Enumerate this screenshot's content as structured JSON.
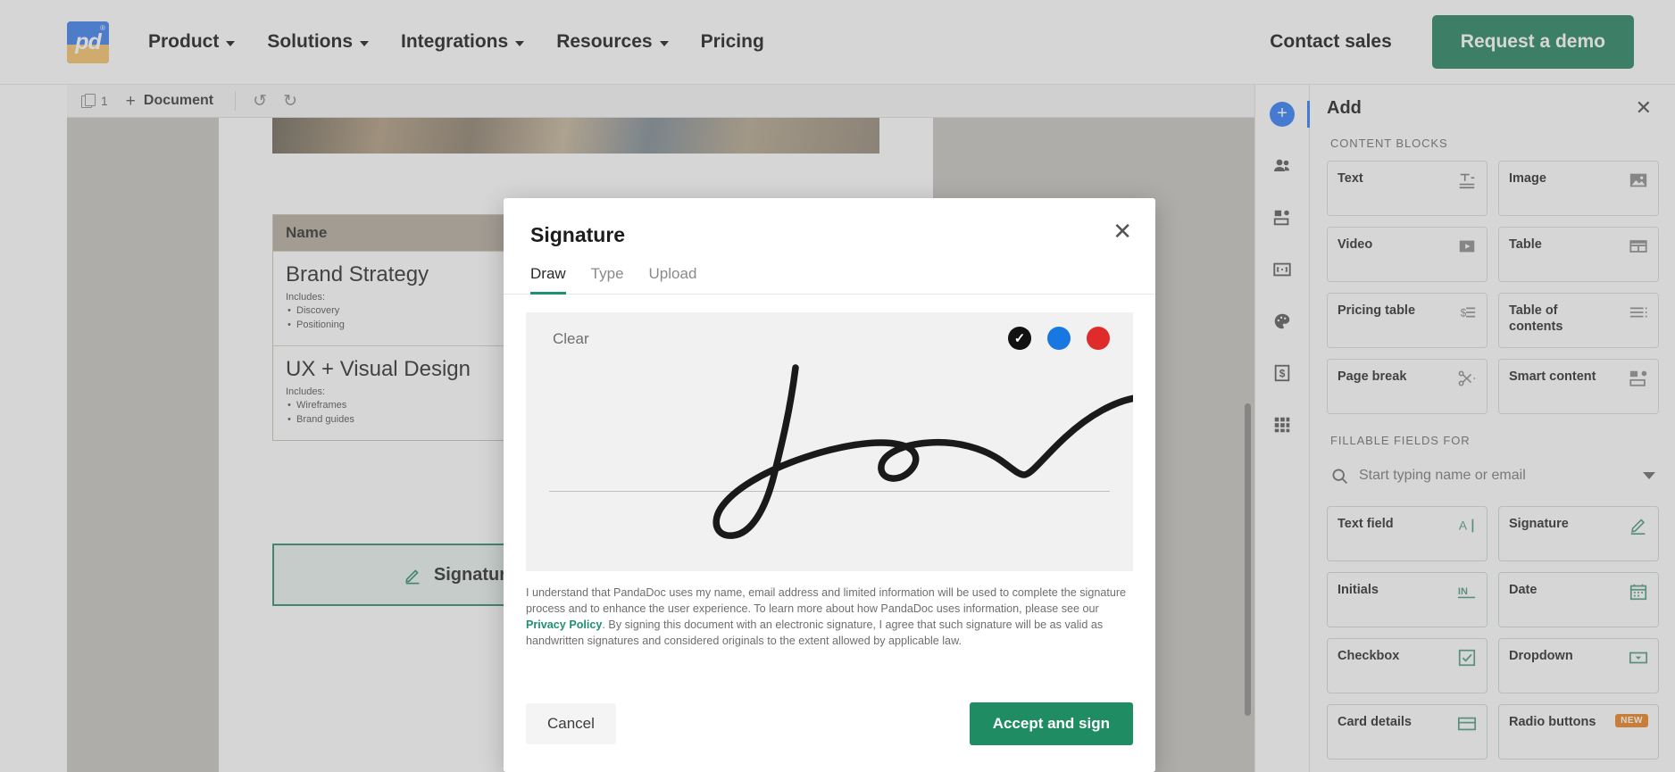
{
  "site_header": {
    "logo_text": "pd",
    "logo_tm": "®",
    "nav": [
      {
        "label": "Product",
        "has_caret": true
      },
      {
        "label": "Solutions",
        "has_caret": true
      },
      {
        "label": "Integrations",
        "has_caret": true
      },
      {
        "label": "Resources",
        "has_caret": true
      },
      {
        "label": "Pricing",
        "has_caret": false
      }
    ],
    "contact_sales": "Contact sales",
    "demo_button": "Request a demo",
    "accent_green": "#23815f",
    "logo_blue": "#3b7ff0",
    "logo_yellow": "#f5c26b"
  },
  "editor_toolbar": {
    "page_count": "1",
    "document_label": "Document",
    "plus_glyph": "+",
    "undo_glyph": "↺",
    "redo_glyph": "↻"
  },
  "document": {
    "table_header": "Name",
    "rows": [
      {
        "title": "Brand Strategy",
        "includes_label": "Includes:",
        "items": [
          "Discovery",
          "Positioning"
        ]
      },
      {
        "title": "UX + Visual Design",
        "includes_label": "Includes:",
        "items": [
          "Wireframes",
          "Brand guides"
        ]
      }
    ],
    "signature_field_label": "Signature",
    "signature_field_border": "#2e8b6a"
  },
  "icon_rail": [
    {
      "name": "add-plus-icon",
      "active": true
    },
    {
      "name": "recipients-icon",
      "active": false
    },
    {
      "name": "content-library-icon",
      "active": false
    },
    {
      "name": "variables-icon",
      "active": false
    },
    {
      "name": "theme-palette-icon",
      "active": false
    },
    {
      "name": "pricing-dollar-icon",
      "active": false
    },
    {
      "name": "apps-grid-icon",
      "active": false
    }
  ],
  "add_panel": {
    "title": "Add",
    "close_glyph": "✕",
    "content_blocks_label": "Content blocks",
    "content_blocks": [
      {
        "label": "Text",
        "icon": "text-block-icon"
      },
      {
        "label": "Image",
        "icon": "image-block-icon"
      },
      {
        "label": "Video",
        "icon": "video-block-icon"
      },
      {
        "label": "Table",
        "icon": "table-block-icon"
      },
      {
        "label": "Pricing table",
        "icon": "pricing-table-icon"
      },
      {
        "label": "Table of contents",
        "icon": "table-of-contents-icon"
      },
      {
        "label": "Page break",
        "icon": "page-break-scissors-icon"
      },
      {
        "label": "Smart content",
        "icon": "smart-content-icon"
      }
    ],
    "fillable_fields_label": "Fillable fields for",
    "search_placeholder": "Start typing name or email",
    "fillable_fields": [
      {
        "label": "Text field",
        "icon": "text-field-icon",
        "badge": ""
      },
      {
        "label": "Signature",
        "icon": "signature-pen-icon",
        "badge": ""
      },
      {
        "label": "Initials",
        "icon": "initials-icon",
        "badge": ""
      },
      {
        "label": "Date",
        "icon": "calendar-icon",
        "badge": ""
      },
      {
        "label": "Checkbox",
        "icon": "checkbox-icon",
        "badge": ""
      },
      {
        "label": "Dropdown",
        "icon": "dropdown-icon",
        "badge": ""
      },
      {
        "label": "Card details",
        "icon": "credit-card-icon",
        "badge": ""
      },
      {
        "label": "Radio buttons",
        "icon": "radio-buttons-icon",
        "badge": "NEW"
      }
    ],
    "badge_color": "#e8821e",
    "field_accent": "#4f9b80"
  },
  "signature_modal": {
    "title": "Signature",
    "close_glyph": "✕",
    "tabs": [
      {
        "label": "Draw",
        "active": true
      },
      {
        "label": "Type",
        "active": false
      },
      {
        "label": "Upload",
        "active": false
      }
    ],
    "active_tab_color": "#1f9171",
    "clear_label": "Clear",
    "colors": [
      {
        "name": "black",
        "hex": "#111111",
        "selected": true
      },
      {
        "name": "blue",
        "hex": "#1877e0",
        "selected": false
      },
      {
        "name": "red",
        "hex": "#e02b2b",
        "selected": false
      }
    ],
    "legal_part1": "I understand that PandaDoc uses my name, email address and limited information will be used to complete the signature process and to enhance the user experience. To learn more about how PandaDoc uses information, please see our ",
    "legal_link": "Privacy Policy",
    "legal_part2": ". By signing this document with an electronic signature, I agree that such signature will be as valid as handwritten signatures and considered originals to the extent allowed by applicable law.",
    "cancel_label": "Cancel",
    "accept_label": "Accept and sign",
    "accept_color": "#1f8c64"
  }
}
